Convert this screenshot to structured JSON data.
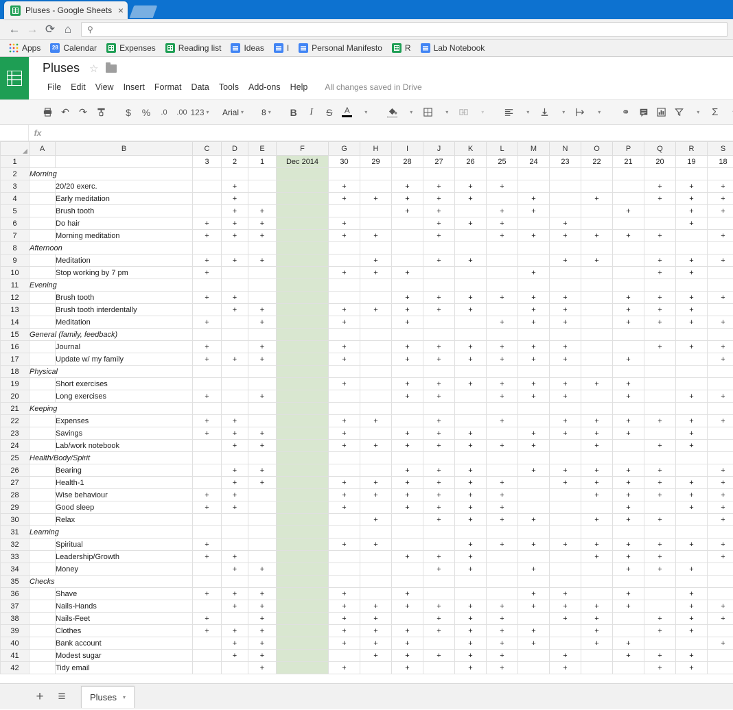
{
  "browser": {
    "tab": {
      "title": "Pluses - Google Sheets",
      "favicon": "sheets-icon",
      "close": "×"
    },
    "nav": {
      "back": "←",
      "forward": "→",
      "reload": "⟳",
      "home": "⌂",
      "search_glyph": "⚲"
    },
    "omnibox": {
      "value": "",
      "placeholder": ""
    },
    "bookmarks": [
      {
        "label": "Apps",
        "icon": "apps-grid-icon"
      },
      {
        "label": "Calendar",
        "icon": "calendar-icon",
        "icon_text": "28"
      },
      {
        "label": "Expenses",
        "icon": "sheets-icon"
      },
      {
        "label": "Reading list",
        "icon": "sheets-icon"
      },
      {
        "label": "Ideas",
        "icon": "docs-icon"
      },
      {
        "label": "I",
        "icon": "docs-icon"
      },
      {
        "label": "Personal Manifesto",
        "icon": "docs-icon"
      },
      {
        "label": "R",
        "icon": "sheets-icon"
      },
      {
        "label": "Lab Notebook",
        "icon": "docs-icon"
      }
    ]
  },
  "app": {
    "logo": "sheets-logo-icon",
    "doc_title": "Pluses",
    "star": "☆",
    "folder": "folder-icon",
    "menus": [
      "File",
      "Edit",
      "View",
      "Insert",
      "Format",
      "Data",
      "Tools",
      "Add-ons",
      "Help"
    ],
    "save_status": "All changes saved in Drive"
  },
  "toolbar": {
    "print": "⎙",
    "undo": "↶",
    "redo": "↷",
    "paint_format": "paint-format-icon",
    "currency": "$",
    "percent": "%",
    "decrease_decimal": ".0",
    "increase_decimal": ".00",
    "more_formats": "123",
    "font_name": "Arial",
    "font_size": "8",
    "bold": "B",
    "italic": "I",
    "strikethrough": "S",
    "text_color": "A",
    "fill_color": "fill-color-icon",
    "borders": "borders-icon",
    "merge_cells": "merge-cells-icon",
    "halign": "align-left-icon",
    "valign": "align-bottom-icon",
    "text_wrap": "text-wrap-icon",
    "insert_link": "⚭",
    "insert_comment": "comment-icon",
    "insert_chart": "chart-icon",
    "filter": "filter-icon",
    "functions": "Σ",
    "caret": "▾"
  },
  "formula_bar": {
    "name_box": "",
    "fx_label": "fx",
    "input_value": ""
  },
  "grid": {
    "columns": [
      "A",
      "B",
      "C",
      "D",
      "E",
      "F",
      "G",
      "H",
      "I",
      "J",
      "K",
      "L",
      "M",
      "N",
      "O",
      "P",
      "Q",
      "R",
      "S"
    ],
    "header_row_number": "1",
    "header_values": {
      "C": "3",
      "D": "2",
      "E": "1",
      "F": "Dec 2014",
      "G": "30",
      "H": "29",
      "I": "28",
      "J": "27",
      "K": "26",
      "L": "25",
      "M": "24",
      "N": "23",
      "O": "22",
      "P": "21",
      "Q": "20",
      "R": "19",
      "S": "18"
    },
    "highlight_column": "F",
    "highlight_color": "#d9e7d0",
    "plus_mark": "+",
    "rows": [
      {
        "n": "2",
        "type": "group",
        "label": "Morning"
      },
      {
        "n": "3",
        "type": "task",
        "label": "20/20 exerc.",
        "marks": [
          "D",
          "G",
          "I",
          "J",
          "K",
          "L",
          "Q",
          "R",
          "S"
        ]
      },
      {
        "n": "4",
        "type": "task",
        "label": "Early meditation",
        "marks": [
          "D",
          "G",
          "H",
          "I",
          "J",
          "K",
          "M",
          "O",
          "Q",
          "R",
          "S"
        ]
      },
      {
        "n": "5",
        "type": "task",
        "label": "Brush tooth",
        "marks": [
          "D",
          "E",
          "I",
          "J",
          "L",
          "M",
          "P",
          "R",
          "S"
        ]
      },
      {
        "n": "6",
        "type": "task",
        "label": "Do hair",
        "marks": [
          "C",
          "D",
          "E",
          "G",
          "J",
          "K",
          "L",
          "N",
          "R"
        ]
      },
      {
        "n": "7",
        "type": "task",
        "label": "Morning meditation",
        "marks": [
          "C",
          "D",
          "E",
          "G",
          "H",
          "J",
          "L",
          "M",
          "N",
          "O",
          "P",
          "Q",
          "S"
        ]
      },
      {
        "n": "8",
        "type": "group",
        "label": "Afternoon"
      },
      {
        "n": "9",
        "type": "task",
        "label": "Meditation",
        "marks": [
          "C",
          "D",
          "E",
          "H",
          "J",
          "K",
          "N",
          "O",
          "Q",
          "R",
          "S"
        ]
      },
      {
        "n": "10",
        "type": "task",
        "label": "Stop working by 7 pm",
        "marks": [
          "C",
          "G",
          "H",
          "I",
          "M",
          "Q",
          "R"
        ]
      },
      {
        "n": "11",
        "type": "group",
        "label": "Evening"
      },
      {
        "n": "12",
        "type": "task",
        "label": "Brush tooth",
        "marks": [
          "C",
          "D",
          "I",
          "J",
          "K",
          "L",
          "M",
          "N",
          "P",
          "Q",
          "R",
          "S"
        ]
      },
      {
        "n": "13",
        "type": "task",
        "label": "Brush tooth interdentally",
        "marks": [
          "D",
          "E",
          "G",
          "H",
          "I",
          "J",
          "K",
          "M",
          "N",
          "P",
          "Q",
          "R"
        ]
      },
      {
        "n": "14",
        "type": "task",
        "label": "Meditation",
        "marks": [
          "C",
          "E",
          "G",
          "I",
          "L",
          "M",
          "N",
          "P",
          "Q",
          "R",
          "S"
        ]
      },
      {
        "n": "15",
        "type": "group",
        "label": "General (family, feedback)"
      },
      {
        "n": "16",
        "type": "task",
        "label": "Journal",
        "marks": [
          "C",
          "E",
          "G",
          "I",
          "J",
          "K",
          "L",
          "M",
          "N",
          "Q",
          "R",
          "S"
        ]
      },
      {
        "n": "17",
        "type": "task",
        "label": "Update w/ my family",
        "marks": [
          "C",
          "D",
          "E",
          "G",
          "I",
          "J",
          "K",
          "L",
          "M",
          "N",
          "P",
          "S"
        ]
      },
      {
        "n": "18",
        "type": "group",
        "label": "Physical"
      },
      {
        "n": "19",
        "type": "task",
        "label": "Short exercises",
        "marks": [
          "G",
          "I",
          "J",
          "K",
          "L",
          "M",
          "N",
          "O",
          "P"
        ]
      },
      {
        "n": "20",
        "type": "task",
        "label": "Long exercises",
        "marks": [
          "C",
          "E",
          "I",
          "J",
          "L",
          "M",
          "N",
          "P",
          "R",
          "S"
        ]
      },
      {
        "n": "21",
        "type": "group",
        "label": "Keeping"
      },
      {
        "n": "22",
        "type": "task",
        "label": "Expenses",
        "marks": [
          "C",
          "D",
          "G",
          "H",
          "J",
          "L",
          "N",
          "O",
          "P",
          "Q",
          "R",
          "S"
        ]
      },
      {
        "n": "23",
        "type": "task",
        "label": "Savings",
        "marks": [
          "C",
          "D",
          "E",
          "G",
          "I",
          "J",
          "K",
          "M",
          "N",
          "O",
          "P",
          "R"
        ]
      },
      {
        "n": "24",
        "type": "task",
        "label": "Lab/work notebook",
        "marks": [
          "D",
          "E",
          "G",
          "H",
          "I",
          "J",
          "K",
          "L",
          "M",
          "O",
          "Q",
          "R"
        ]
      },
      {
        "n": "25",
        "type": "group",
        "label": "Health/Body/Spirit"
      },
      {
        "n": "26",
        "type": "task",
        "label": "Bearing",
        "marks": [
          "D",
          "E",
          "I",
          "J",
          "K",
          "M",
          "N",
          "O",
          "P",
          "Q",
          "S"
        ]
      },
      {
        "n": "27",
        "type": "task",
        "label": "Health-1",
        "marks": [
          "D",
          "E",
          "G",
          "H",
          "I",
          "J",
          "K",
          "L",
          "N",
          "O",
          "P",
          "Q",
          "R",
          "S"
        ]
      },
      {
        "n": "28",
        "type": "task",
        "label": "Wise behaviour",
        "marks": [
          "C",
          "D",
          "G",
          "H",
          "I",
          "J",
          "K",
          "L",
          "O",
          "P",
          "Q",
          "R",
          "S"
        ]
      },
      {
        "n": "29",
        "type": "task",
        "label": "Good sleep",
        "marks": [
          "C",
          "D",
          "G",
          "I",
          "J",
          "K",
          "L",
          "P",
          "R",
          "S"
        ]
      },
      {
        "n": "30",
        "type": "task",
        "label": "Relax",
        "marks": [
          "H",
          "J",
          "K",
          "L",
          "M",
          "O",
          "P",
          "Q",
          "S"
        ]
      },
      {
        "n": "31",
        "type": "group",
        "label": "Learning"
      },
      {
        "n": "32",
        "type": "task",
        "label": "Spiritual",
        "marks": [
          "C",
          "G",
          "H",
          "K",
          "L",
          "M",
          "N",
          "O",
          "P",
          "Q",
          "R",
          "S"
        ]
      },
      {
        "n": "33",
        "type": "task",
        "label": "Leadership/Growth",
        "marks": [
          "C",
          "D",
          "I",
          "J",
          "K",
          "O",
          "P",
          "Q",
          "S"
        ]
      },
      {
        "n": "34",
        "type": "task",
        "label": "Money",
        "marks": [
          "D",
          "E",
          "J",
          "K",
          "M",
          "P",
          "Q",
          "R"
        ]
      },
      {
        "n": "35",
        "type": "group",
        "label": "Checks"
      },
      {
        "n": "36",
        "type": "task",
        "label": "Shave",
        "marks": [
          "C",
          "D",
          "E",
          "G",
          "I",
          "M",
          "N",
          "P",
          "R"
        ]
      },
      {
        "n": "37",
        "type": "task",
        "label": "Nails-Hands",
        "marks": [
          "D",
          "E",
          "G",
          "H",
          "I",
          "J",
          "K",
          "L",
          "M",
          "N",
          "O",
          "P",
          "R",
          "S"
        ]
      },
      {
        "n": "38",
        "type": "task",
        "label": "Nails-Feet",
        "marks": [
          "C",
          "E",
          "G",
          "H",
          "J",
          "K",
          "L",
          "N",
          "O",
          "Q",
          "R",
          "S"
        ]
      },
      {
        "n": "39",
        "type": "task",
        "label": "Clothes",
        "marks": [
          "C",
          "D",
          "E",
          "G",
          "H",
          "I",
          "J",
          "K",
          "L",
          "M",
          "O",
          "Q",
          "R"
        ]
      },
      {
        "n": "40",
        "type": "task",
        "label": "Bank account",
        "marks": [
          "D",
          "E",
          "G",
          "H",
          "I",
          "K",
          "L",
          "M",
          "O",
          "P",
          "S"
        ]
      },
      {
        "n": "41",
        "type": "task",
        "label": "Modest sugar",
        "marks": [
          "D",
          "E",
          "H",
          "I",
          "J",
          "K",
          "L",
          "N",
          "P",
          "Q",
          "R"
        ]
      },
      {
        "n": "42",
        "type": "task",
        "label": "Tidy email",
        "marks": [
          "E",
          "G",
          "I",
          "K",
          "L",
          "N",
          "Q",
          "R"
        ]
      }
    ]
  },
  "bottom": {
    "add_sheet": "+",
    "all_sheets": "≡",
    "sheet_name": "Pluses",
    "sheet_caret": "▾"
  }
}
